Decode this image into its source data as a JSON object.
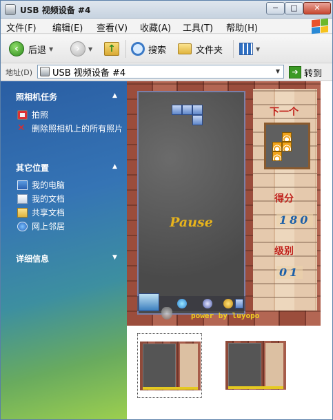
{
  "window": {
    "title": "USB 视频设备 #4",
    "controls": {
      "minimize": "−",
      "maximize": "□",
      "close": "✕"
    }
  },
  "menu": {
    "items": [
      "文件(F)",
      "编辑(E)",
      "查看(V)",
      "收藏(A)",
      "工具(T)",
      "帮助(H)"
    ]
  },
  "toolbar": {
    "back_label": "后退",
    "search_label": "搜索",
    "folders_label": "文件夹"
  },
  "address": {
    "label": "地址(D)",
    "value": "USB 视频设备 #4",
    "go_label": "转到"
  },
  "taskpane": {
    "camera_tasks": {
      "title": "照相机任务",
      "items": [
        "拍照",
        "删除照相机上的所有照片"
      ]
    },
    "other_places": {
      "title": "其它位置",
      "items": [
        "我的电脑",
        "我的文档",
        "共享文档",
        "网上邻居"
      ]
    },
    "details": {
      "title": "详细信息"
    }
  },
  "game": {
    "pause_text": "Pause",
    "next_label": "下一个",
    "score_label": "得分",
    "score_value": "180",
    "level_label": "级别",
    "level_value": "01",
    "credit": "power by luyopo"
  },
  "thumbnails": {
    "count": 2,
    "selected_index": 0
  }
}
